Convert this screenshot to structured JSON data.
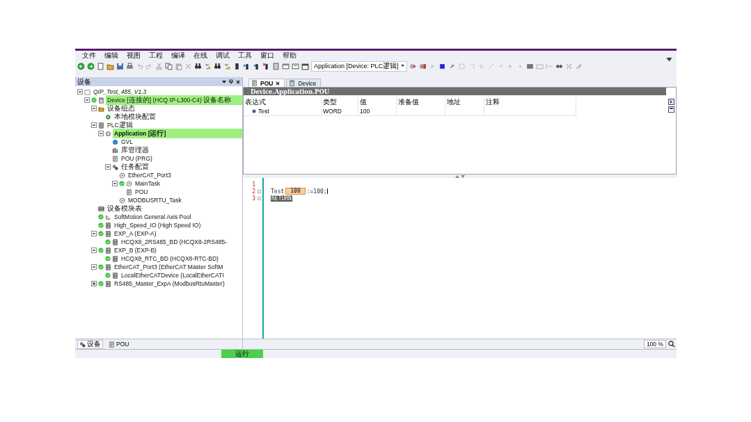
{
  "menu": [
    "文件",
    "编辑",
    "视图",
    "工程",
    "编译",
    "在线",
    "调试",
    "工具",
    "窗口",
    "帮助"
  ],
  "toolbar": {
    "application_selector": "Application [Device: PLC逻辑]"
  },
  "devices_panel": {
    "title": "设备",
    "tree": [
      {
        "label": "QIP_Test_485_V1.3",
        "kind": "project",
        "expanded": true,
        "running": false,
        "highlighted": false,
        "children": [
          {
            "label": "Device [连接的] (HCQ IP-L300-C4) 设备名称",
            "kind": "device",
            "expanded": true,
            "running": true,
            "highlighted": true,
            "children": [
              {
                "label": "设备组态",
                "kind": "config",
                "expanded": true,
                "running": false,
                "highlighted": false,
                "children": [
                  {
                    "label": "本地模块配置",
                    "kind": "module",
                    "running": false,
                    "highlighted": false
                  }
                ]
              },
              {
                "label": "PLC逻辑",
                "kind": "plc",
                "expanded": true,
                "running": false,
                "highlighted": false,
                "children": [
                  {
                    "label": "Application [运行]",
                    "kind": "app",
                    "expanded": true,
                    "running": false,
                    "highlighted": true,
                    "children": [
                      {
                        "label": "GVL",
                        "kind": "gvl",
                        "running": false,
                        "highlighted": false
                      },
                      {
                        "label": "库管理器",
                        "kind": "lib",
                        "running": false,
                        "highlighted": false
                      },
                      {
                        "label": "POU (PRG)",
                        "kind": "pou",
                        "running": false,
                        "highlighted": false
                      },
                      {
                        "label": "任务配置",
                        "kind": "tasks",
                        "expanded": true,
                        "running": false,
                        "highlighted": false,
                        "children": [
                          {
                            "label": "EtherCAT_Port3",
                            "kind": "task",
                            "running": false,
                            "highlighted": false
                          },
                          {
                            "label": "MainTask",
                            "kind": "task",
                            "expanded": true,
                            "running": true,
                            "highlighted": false,
                            "children": [
                              {
                                "label": "POU",
                                "kind": "pou",
                                "running": false,
                                "highlighted": false
                              }
                            ]
                          },
                          {
                            "label": "MODBUSRTU_Task",
                            "kind": "task",
                            "running": false,
                            "highlighted": false
                          }
                        ]
                      }
                    ]
                  }
                ]
              },
              {
                "label": "设备模块表",
                "kind": "table",
                "running": false,
                "highlighted": false
              },
              {
                "label": "SoftMotion General Axis Pool",
                "kind": "axis",
                "running": true,
                "highlighted": false
              },
              {
                "label": "High_Speed_IO (High Speed IO)",
                "kind": "io",
                "running": true,
                "highlighted": false
              },
              {
                "label": "EXP_A (EXP-A)",
                "kind": "io",
                "expanded": true,
                "running": true,
                "highlighted": false,
                "children": [
                  {
                    "label": "HCQX8_2RS485_BD (HCQX8-2RS485-",
                    "kind": "io",
                    "running": true,
                    "highlighted": false
                  }
                ]
              },
              {
                "label": "EXP_B (EXP-B)",
                "kind": "io",
                "expanded": true,
                "running": true,
                "highlighted": false,
                "children": [
                  {
                    "label": "HCQX8_RTC_BD (HCQX8-RTC-BD)",
                    "kind": "io",
                    "running": true,
                    "highlighted": false
                  }
                ]
              },
              {
                "label": "EtherCAT_Port3 (EtherCAT Master SoftM",
                "kind": "io",
                "expanded": true,
                "running": true,
                "highlighted": false,
                "children": [
                  {
                    "label": "LocalEtherCATDevice (LocalEtherCATI",
                    "kind": "io",
                    "running": true,
                    "highlighted": false
                  }
                ]
              },
              {
                "label": "RS485_Master_ExpA (ModbusRtuMaster)",
                "kind": "io",
                "expanded": false,
                "running": true,
                "highlighted": false
              }
            ]
          }
        ]
      }
    ],
    "bottom_tabs": [
      {
        "label": "设备",
        "selected": true
      },
      {
        "label": "POU",
        "selected": false
      }
    ]
  },
  "editor_tabs": [
    {
      "label": "POU",
      "selected": true
    },
    {
      "label": "Device",
      "selected": false
    }
  ],
  "watch": {
    "path": "Device.Application.POU",
    "columns": [
      "表达式",
      "类型",
      "值",
      "准备值",
      "地址",
      "注释"
    ],
    "rows": [
      {
        "expression": "Test",
        "type": "WORD",
        "value": "100"
      }
    ]
  },
  "code": {
    "lines": [
      {
        "number": "1"
      },
      {
        "number": "2",
        "tokens": [
          {
            "kind": "ident",
            "text": "Test"
          },
          {
            "kind": "monitor",
            "text": "100"
          },
          {
            "kind": "code",
            "text": ":=100;"
          }
        ],
        "caret": true
      },
      {
        "number": "3",
        "tokens": [
          {
            "kind": "keyword",
            "text": "RETURN"
          }
        ],
        "caret": false
      }
    ]
  },
  "zoom": "100 %",
  "status": {
    "state": "运行"
  }
}
